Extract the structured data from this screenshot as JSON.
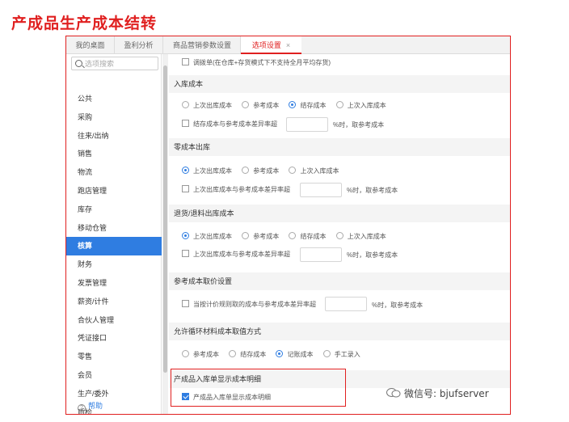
{
  "title": "产成品生产成本结转",
  "tabs": [
    {
      "label": "我的桌面"
    },
    {
      "label": "盈利分析"
    },
    {
      "label": "商品营销参数设置"
    },
    {
      "label": "选项设置",
      "close": "×"
    }
  ],
  "sidebar": {
    "search_placeholder": "选项搜索",
    "items": [
      {
        "label": "公共"
      },
      {
        "label": "采购"
      },
      {
        "label": "往来/出纳"
      },
      {
        "label": "销售"
      },
      {
        "label": "物流"
      },
      {
        "label": "跑店管理"
      },
      {
        "label": "库存"
      },
      {
        "label": "移动仓管"
      },
      {
        "label": "核算",
        "active": true
      },
      {
        "label": "财务"
      },
      {
        "label": "发票管理"
      },
      {
        "label": "薪资/计件"
      },
      {
        "label": "合伙人管理"
      },
      {
        "label": "凭证接口"
      },
      {
        "label": "零售"
      },
      {
        "label": "会员"
      },
      {
        "label": "生产/委外"
      },
      {
        "label": "质检"
      }
    ],
    "help": "帮助"
  },
  "content": {
    "top_checkbox": "调拨单(在仓库+存货模式下不支持全月平均存货)",
    "inbound": {
      "heading": "入库成本",
      "options": [
        "上次出库成本",
        "参考成本",
        "结存成本",
        "上次入库成本"
      ],
      "selected": 2,
      "check_label": "结存成本与参考成本差异率超",
      "suffix": "%时，取参考成本"
    },
    "zero_cost": {
      "heading": "零成本出库",
      "options": [
        "上次出库成本",
        "参考成本",
        "上次入库成本"
      ],
      "selected": 0,
      "check_label": "上次出库成本与参考成本差异率超",
      "suffix": "%时，取参考成本"
    },
    "return_cost": {
      "heading": "退货/退料出库成本",
      "options": [
        "上次出库成本",
        "参考成本",
        "结存成本",
        "上次入库成本"
      ],
      "selected": 0,
      "check_label": "上次出库成本与参考成本差异率超",
      "suffix": "%时，取参考成本"
    },
    "ref_cost": {
      "heading": "参考成本取价设置",
      "check_label": "当按计价规则取的成本与参考成本差异率超",
      "suffix": "%时，取参考成本"
    },
    "recycle": {
      "heading": "允许循环材料成本取值方式",
      "options": [
        "参考成本",
        "结存成本",
        "记账成本",
        "手工录入"
      ],
      "selected": 2
    },
    "product_detail": {
      "heading": "产成品入库单显示成本明细",
      "check_label": "产成品入库单显示成本明细",
      "checked": true
    }
  },
  "watermark": "微信号: bjufserver",
  "colors": {
    "accent": "#2f7de1",
    "highlight": "#e02020"
  }
}
